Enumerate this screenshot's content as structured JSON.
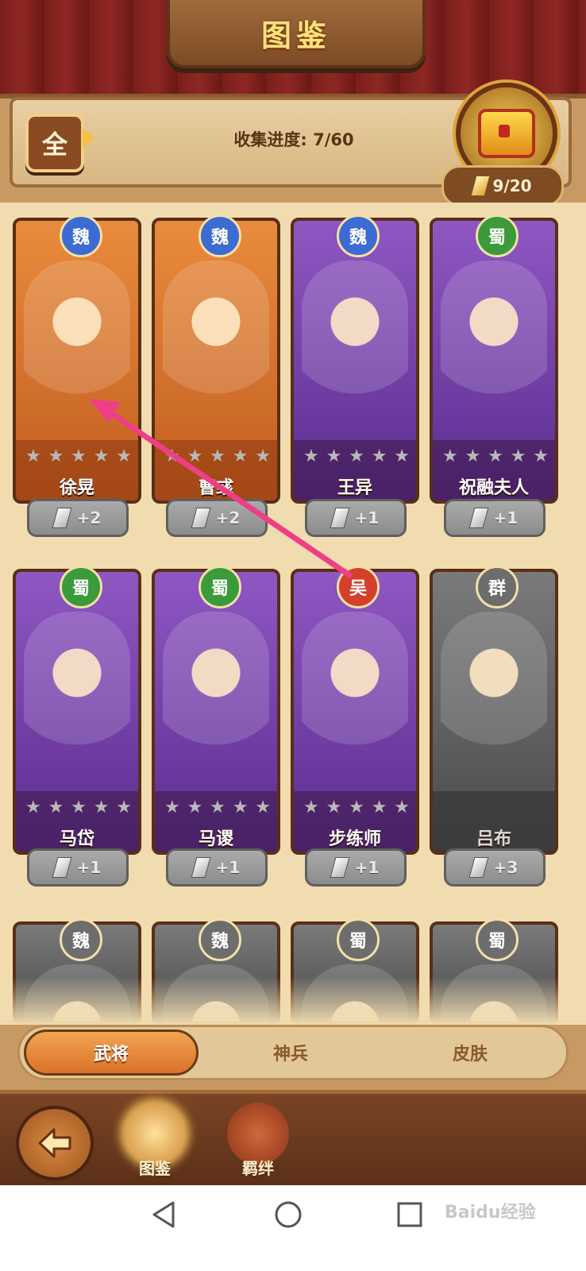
{
  "title": "图鉴",
  "header": {
    "filter_label": "全",
    "progress_label": "收集进度: 7/60",
    "chest_fragments": "9/20"
  },
  "heroes": [
    {
      "name": "徐晃",
      "faction": "魏",
      "fragments": "+2"
    },
    {
      "name": "曹彧",
      "faction": "魏",
      "fragments": "+2"
    },
    {
      "name": "王异",
      "faction": "魏",
      "fragments": "+1"
    },
    {
      "name": "祝融夫人",
      "faction": "蜀",
      "fragments": "+1"
    },
    {
      "name": "马岱",
      "faction": "蜀",
      "fragments": "+1"
    },
    {
      "name": "马谡",
      "faction": "蜀",
      "fragments": "+1"
    },
    {
      "name": "步练师",
      "faction": "吴",
      "fragments": "+1"
    },
    {
      "name": "吕布",
      "faction": "群",
      "fragments": "+3"
    },
    {
      "name": "",
      "faction": "魏",
      "fragments": ""
    },
    {
      "name": "",
      "faction": "魏",
      "fragments": ""
    },
    {
      "name": "",
      "faction": "蜀",
      "fragments": ""
    },
    {
      "name": "",
      "faction": "蜀",
      "fragments": ""
    }
  ],
  "tabs": [
    "武将",
    "神兵",
    "皮肤"
  ],
  "bottom_nav": {
    "atlas": "图鉴",
    "bond": "羁绊"
  },
  "watermark": "Baidu经验",
  "colors": {
    "accent": "#d9722a",
    "wei": "#3c6bd1",
    "shu": "#3b9a3a",
    "wu": "#d5402a",
    "qun": "#6d6d6d",
    "annotation_arrow": "#ee3f86"
  }
}
